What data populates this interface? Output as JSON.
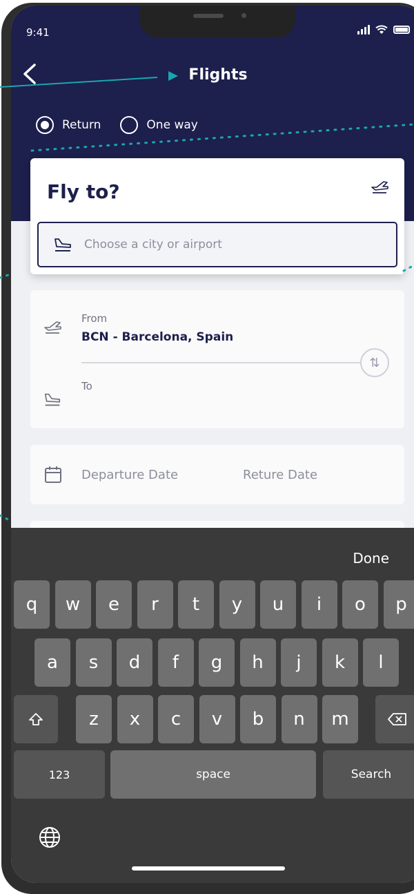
{
  "status_bar": {
    "time": "9:41"
  },
  "header": {
    "title": "Flights"
  },
  "trip_type": {
    "options": [
      "Return",
      "One way"
    ],
    "selected": "Return"
  },
  "fly_to": {
    "title": "Fly to?",
    "placeholder": "Choose a city or airport"
  },
  "route": {
    "from_label": "From",
    "from_value": "BCN - Barcelona, Spain",
    "to_label": "To"
  },
  "dates": {
    "departure": "Departure Date",
    "return": "Reture Date"
  },
  "keyboard": {
    "done": "Done",
    "row1": [
      "q",
      "w",
      "e",
      "r",
      "t",
      "y",
      "u",
      "i",
      "o",
      "p"
    ],
    "row2": [
      "a",
      "s",
      "d",
      "f",
      "g",
      "h",
      "j",
      "k",
      "l"
    ],
    "row3": [
      "z",
      "x",
      "c",
      "v",
      "b",
      "n",
      "m"
    ],
    "numbers": "123",
    "space": "space",
    "search": "Search"
  },
  "colors": {
    "navy": "#1d1f4c",
    "teal": "#1aa6b0"
  }
}
